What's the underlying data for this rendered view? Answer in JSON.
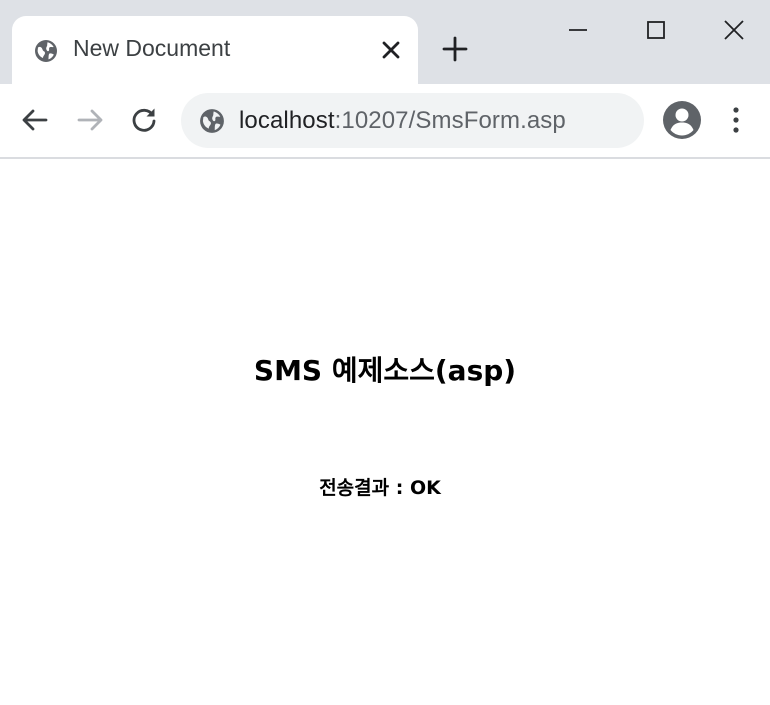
{
  "browser": {
    "tab": {
      "title": "New Document",
      "favicon": "globe-icon"
    },
    "new_tab_icon": "plus-icon",
    "window_controls": [
      "minimize-icon",
      "maximize-icon",
      "close-icon"
    ],
    "nav": [
      "back-arrow-icon",
      "forward-arrow-icon",
      "reload-icon"
    ],
    "address_bar": {
      "site_icon": "globe-icon",
      "host": "localhost",
      "path": ":10207/SmsForm.asp"
    },
    "profile_icon": "account-circle-icon",
    "menu_icon": "kebab-menu-icon",
    "colors": {
      "tabstrip": "#dee1e6",
      "omnibox": "#f1f3f4",
      "icon": "#5f6368",
      "disabled_icon": "#b0b3b8"
    }
  },
  "page": {
    "heading": "SMS 예제소스(asp)",
    "result_label": "전송결과",
    "result_separator": " : ",
    "result_value": "OK"
  }
}
